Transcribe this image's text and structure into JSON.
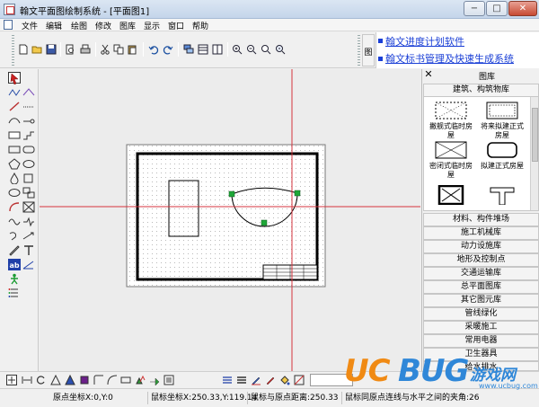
{
  "window": {
    "title": "翰文平面图绘制系统 - [平面图1]",
    "buttons": [
      "−",
      "□",
      "✕"
    ]
  },
  "menu": [
    "文件",
    "编辑",
    "绘图",
    "修改",
    "图库",
    "显示",
    "窗口",
    "帮助"
  ],
  "toolbar": {
    "icons": [
      "new-file-icon",
      "open-folder-icon",
      "save-icon",
      "print-preview-icon",
      "print-icon",
      "cut-icon",
      "copy-icon",
      "paste-icon",
      "undo-icon",
      "redo-icon",
      "layer-icon",
      "layout-icon",
      "panel-icon",
      "zoom-in-icon",
      "zoom-out-icon",
      "zoom-window-icon",
      "zoom-all-icon"
    ],
    "ad_box_label": "图",
    "ad_links": [
      "翰文进度计划软件",
      "翰文标书管理及快速生成系统"
    ],
    "colors": {
      "link": "#1a3fd6"
    }
  },
  "left_tools": [
    "select-arrow-icon",
    "polyline-icon",
    "line-icon",
    "arc-icon",
    "rectangle-icon",
    "ellipse-icon",
    "polygon-icon",
    "circle-icon",
    "fill-icon",
    "text-icon",
    "wave-icon",
    "dimension-icon",
    "text-ab-icon",
    "figure-icon"
  ],
  "canvas": {
    "background": "#ececec",
    "crosshair_color": "#d6333c",
    "grip_color": "#1ea838"
  },
  "library": {
    "close": "✕",
    "title": "图库",
    "active_category": "建筑、构筑物库",
    "items": [
      {
        "label": "撇舰式临时房屋",
        "icon": "temp-house-icon"
      },
      {
        "label": "将来拟建正式房屋",
        "icon": "future-house-icon"
      },
      {
        "label": "密闭式临时房屋",
        "icon": "closed-temp-house-icon"
      },
      {
        "label": "拟建正式房屋",
        "icon": "planned-house-icon"
      },
      {
        "label": "",
        "icon": "boxed-x-icon"
      },
      {
        "label": "",
        "icon": "t-shape-icon"
      }
    ],
    "categories": [
      "材料、构件堆场",
      "施工机械库",
      "动力设施库",
      "地形及控制点",
      "交通运输库",
      "总平面图库",
      "其它图元库",
      "管线绿化",
      "采暖施工",
      "常用电器",
      "卫生器具",
      "给水排水"
    ]
  },
  "bottombar": {
    "icons": [
      "move-icon",
      "mirror-icon",
      "rotate-icon",
      "triangle-icon",
      "fill-triangle-icon",
      "square-icon",
      "corner-icon",
      "curve-icon",
      "rect-small-icon",
      "copy-shape-icon",
      "arrow-shape-icon",
      "align-icon",
      "lines-icon",
      "lines2-icon",
      "pen-icon",
      "pen2-icon",
      "paint-icon",
      "fill-color-icon"
    ]
  },
  "status": {
    "origin": "原点坐标X:0,Y:0",
    "cursor": "鼠标坐标X:250.33,Y:119.14",
    "distance": "鼠标与原点距离:250.33",
    "angle": "鼠标同原点连线与水平之间的夹角:26"
  },
  "watermark": {
    "uc": "UC",
    "bug": "BUG",
    "cn": "游戏网",
    "domain": "www.ucbug.com",
    "colors": {
      "uc": "#f08a14",
      "bug": "#2f87d8"
    }
  }
}
